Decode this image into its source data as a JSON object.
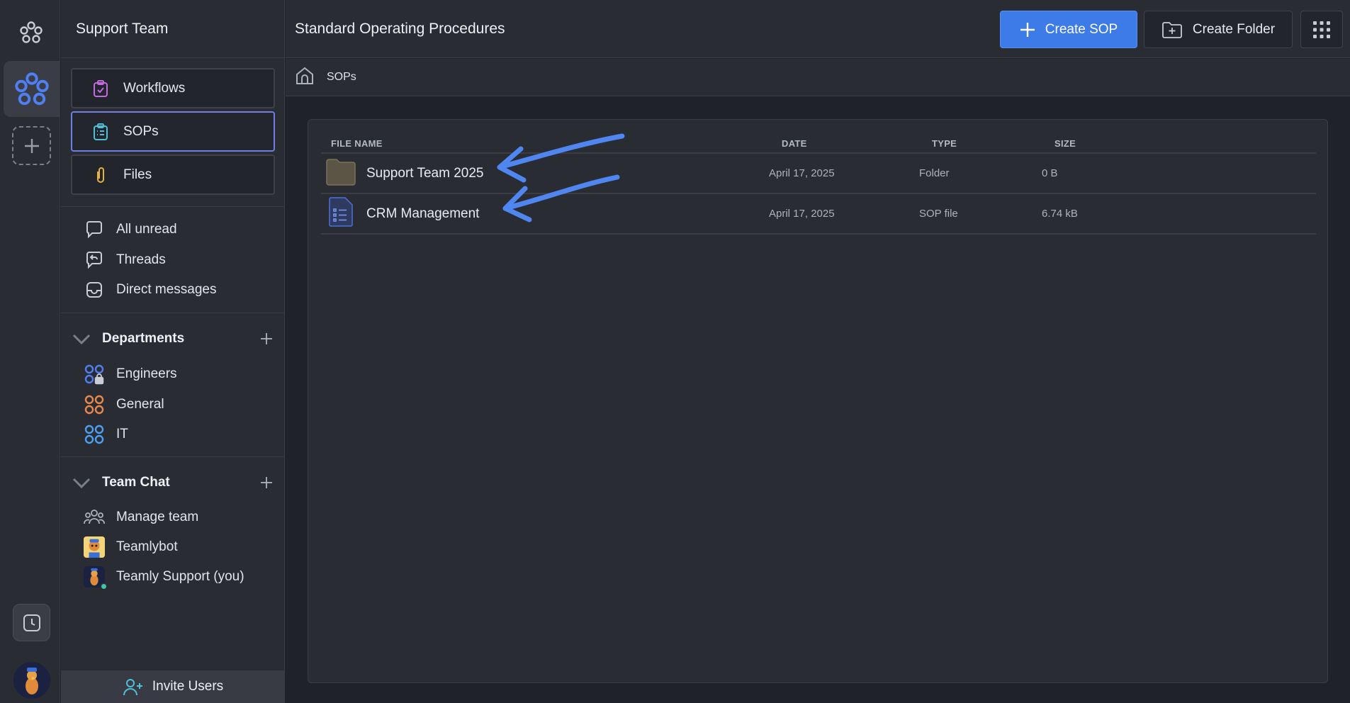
{
  "sidebar": {
    "workspace_title": "Support Team",
    "nav": [
      {
        "label": "Workflows",
        "icon": "clipboard-check-icon"
      },
      {
        "label": "SOPs",
        "icon": "list-document-icon",
        "active": true
      },
      {
        "label": "Files",
        "icon": "paperclip-icon"
      }
    ],
    "inbox": [
      {
        "label": "All unread",
        "icon": "chat-bubble-icon"
      },
      {
        "label": "Threads",
        "icon": "reply-bubble-icon"
      },
      {
        "label": "Direct messages",
        "icon": "inbox-icon"
      }
    ],
    "departments": {
      "title": "Departments",
      "items": [
        {
          "label": "Engineers",
          "icon": "private-channel-icon",
          "color": "#4f7ff0"
        },
        {
          "label": "General",
          "icon": "channel-icon",
          "color": "#e8894a"
        },
        {
          "label": "IT",
          "icon": "channel-icon",
          "color": "#4f9ff0"
        }
      ]
    },
    "team_chat": {
      "title": "Team Chat",
      "items": [
        {
          "label": "Manage team",
          "icon": "team-icon"
        },
        {
          "label": "Teamlybot",
          "icon": "bot-avatar"
        },
        {
          "label": "Teamly Support (you)",
          "icon": "user-avatar"
        }
      ]
    },
    "invite_label": "Invite Users"
  },
  "header": {
    "title": "Standard Operating Procedures",
    "create_sop_label": "Create SOP",
    "create_folder_label": "Create Folder"
  },
  "breadcrumb": {
    "current": "SOPs"
  },
  "table": {
    "columns": [
      "FILE NAME",
      "DATE",
      "TYPE",
      "SIZE"
    ],
    "rows": [
      {
        "name": "Support Team 2025",
        "date": "April 17, 2025",
        "type": "Folder",
        "size": "0 B",
        "icon": "folder-icon"
      },
      {
        "name": "CRM Management",
        "date": "April 17, 2025",
        "type": "SOP file",
        "size": "6.74 kB",
        "icon": "sop-file-icon"
      }
    ]
  },
  "colors": {
    "accent": "#3d7be8",
    "annotation_arrow": "#4f86f0",
    "active_border": "#6d7fe6"
  }
}
